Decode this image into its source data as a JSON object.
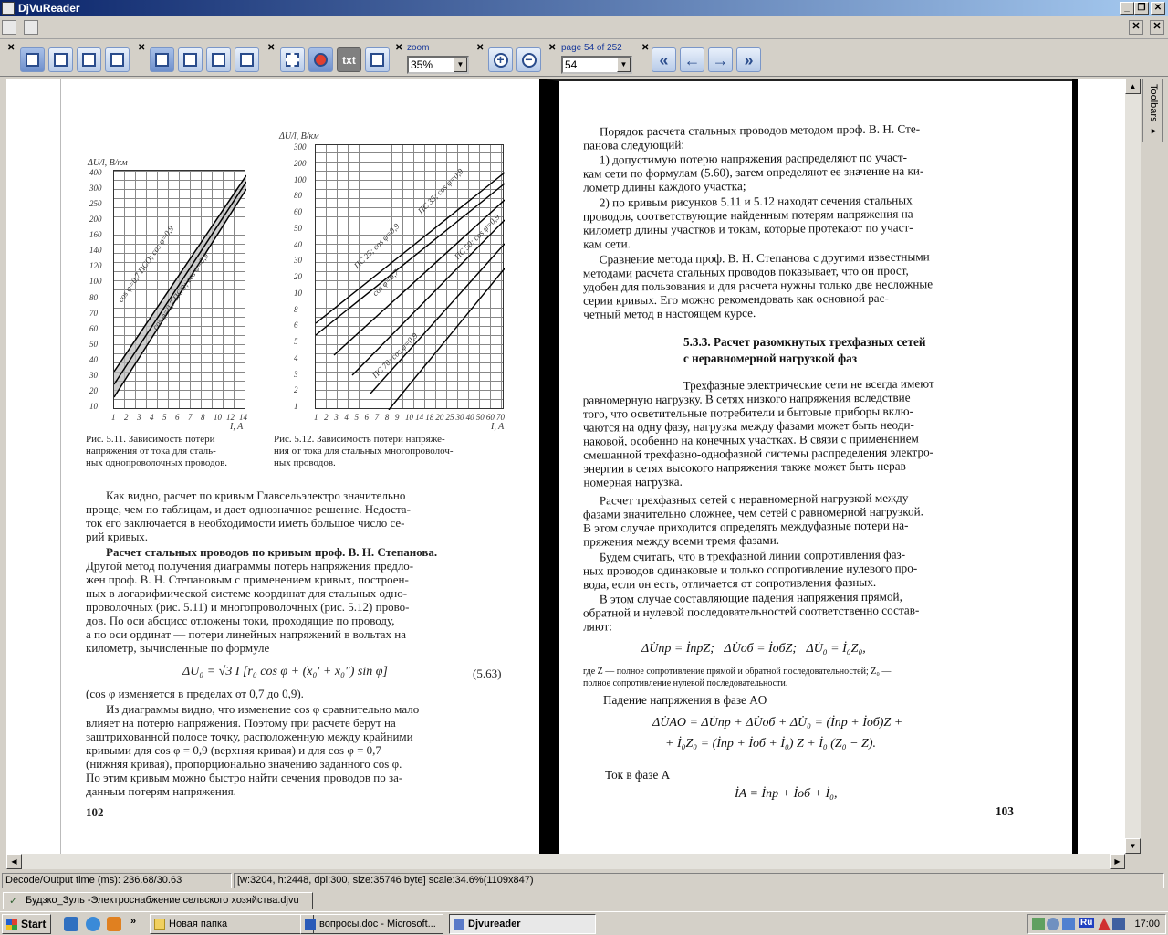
{
  "app": {
    "title": "DjVuReader"
  },
  "toolbar": {
    "zoom_label": "zoom",
    "zoom_value": "35%",
    "page_label": "page 54 of 252",
    "page_value": "54",
    "txt_button": "txt"
  },
  "side": {
    "toolbars_label": "Toolbars ▸"
  },
  "status": {
    "decode": "Decode/Output time (ms): 236.68/30.63",
    "info": "[w:3204, h:2448, dpi:300, size:35746 byte] scale:34.6%(1109x847)"
  },
  "file_tab": {
    "label": "Будзко_Зуль -Электроснабжение сельского хозяйства.djvu"
  },
  "taskbar": {
    "start": "Start",
    "tasks": [
      "Новая папка",
      "вопросы.doc - Microsoft...",
      "Djvureader"
    ],
    "lang": "Ru",
    "clock": "17:00"
  },
  "left_page": {
    "fig1_ylabel": "ΔU/l, В/км",
    "fig1_yticks": [
      "400",
      "300",
      "250",
      "200",
      "160",
      "140",
      "120",
      "100",
      "80",
      "70",
      "60",
      "50",
      "40",
      "30",
      "20",
      "10"
    ],
    "fig1_xticks": [
      "1",
      "2",
      "3",
      "4",
      "5",
      "6",
      "7",
      "8",
      "10",
      "12",
      "14"
    ],
    "fig1_curves": [
      "cos φ=0,7 ПСО; cos φ=0,9",
      "cos φ=0,7 ПСО; cos φ=0,9"
    ],
    "fig2_ylabel": "ΔU/l, В/км",
    "fig2_yticks": [
      "300",
      "200",
      "100",
      "80",
      "60",
      "50",
      "40",
      "30",
      "20",
      "10",
      "8",
      "6",
      "5",
      "4",
      "3",
      "2",
      "1"
    ],
    "fig2_xticks": [
      "1",
      "2",
      "3",
      "4",
      "5",
      "6",
      "7",
      "8",
      "9",
      "10",
      "14",
      "18",
      "20",
      "25",
      "30",
      "40",
      "50",
      "60",
      "70"
    ],
    "fig2_curves": [
      "ПС 25; cos φ=0,9",
      "cos φ=0,7",
      "ПС 35; cos φ=0,9",
      "ПС 50; cos φ=0,9",
      "ПС 70; cos φ=0,9"
    ],
    "axis_i": "I, A",
    "cap1": "Рис. 5.11. Зависимость потери\nнапряжения от тока для сталь-\nных однопроволочных проводов.",
    "cap2": "Рис. 5.12. Зависимость потери напряже-\nния от тока для стальных многопроволоч-\nных проводов.",
    "body1": "Как видно, расчет по кривым Главсельэлектро значительно\nпроще, чем по таблицам, и дает однозначное решение. Недоста-\nток его заключается в необходимости иметь большое число се-\nрий кривых.",
    "heading": "Расчет стальных проводов по кривым проф. В. Н. Степанова.",
    "body2": "Другой метод получения диаграммы потерь напряжения предло-\nжен проф. В. Н. Степановым с применением кривых, построен-\nных в логарифмической системе координат для стальных одно-\nпроволочных (рис. 5.11) и многопроволочных (рис. 5.12) прово-\nдов. По оси абсцисс отложены токи, проходящие по проводу,\nа по оси ординат — потери линейных напряжений в вольтах на\nкилометр, вычисленные по формуле",
    "formula": "ΔU₀ = √3 I [r₀ cos φ + (x₀′ + x₀″) sin φ]",
    "formula_no": "(5.63)",
    "body3": "(cos φ изменяется в пределах от 0,7 до 0,9).",
    "body4": "Из диаграммы видно, что изменение cos φ сравнительно мало\nвлияет на потерю напряжения. Поэтому при расчете берут на\nзаштрихованной полосе точку, расположенную между крайними\nкривыми для cos φ = 0,9 (верхняя кривая) и для cos φ = 0,7\n(нижняя кривая), пропорционально значению заданного cos φ.\nПо этим кривым можно быстро найти сечения проводов по за-\nданным потерям напряжения.",
    "page_no": "102"
  },
  "right_page": {
    "p1": "Порядок расчета стальных проводов методом проф. В. Н. Сте-\nпанова следующий:",
    "p2": "1) допустимую потерю напряжения распределяют по участ-\nкам сети по формулам (5.60), затем определяют ее значение на ки-\nлометр длины каждого участка;",
    "p3": "2) по кривым рисунков 5.11 и 5.12 находят сечения стальных\nпроводов, соответствующие найденным потерям напряжения на\nкилометр длины участков и токам, которые протекают по участ-\nкам сети.",
    "p4": "Сравнение метода проф. В. Н. Степанова с другими известными\nметодами расчета стальных проводов показывает, что он прост,\nудобен для пользования и для расчета нужны только две несложные\nсерии кривых. Его можно рекомендовать как основной рас-\nчетный метод в настоящем курсе.",
    "h1": "5.3.3. Расчет разомкнутых трехфазных сетей",
    "h2": "с неравномерной нагрузкой фаз",
    "p5": "Трехфазные электрические сети не всегда имеют\nравномерную нагрузку. В сетях низкого напряжения вследствие\nтого, что осветительные потребители и бытовые приборы вклю-\nчаются на одну фазу, нагрузка между фазами может быть неоди-\nнаковой, особенно на конечных участках. В связи с применением\nсмешанной трехфазно-однофазной системы распределения электро-\nэнергии в сетях высокого напряжения также может быть нерав-\nномерная нагрузка.",
    "p6": "Расчет трехфазных сетей с неравномерной нагрузкой между\nфазами значительно сложнее, чем сетей с равномерной нагрузкой.\nВ этом случае приходится определять междуфазные потери на-\nпряжения между всеми тремя фазами.",
    "p7": "Будем считать, что в трехфазной линии сопротивления фаз-\nных проводов одинаковые и только сопротивление нулевого про-\nвода, если он есть, отличается от сопротивления фазных.",
    "p8": "В этом случае составляющие падения напряжения прямой,\nобратной и нулевой последовательностей соответственно состав-\nляют:",
    "eq1": "ΔU̇пр = İпрZ;   ΔU̇об = İобZ;   ΔU̇₀ = İ₀Z₀,",
    "note": "где Z — полное сопротивление прямой и обратной последовательностей; Z₀ —\nполное сопротивление нулевой последовательности.",
    "p9": "Падение напряжения в фазе AO",
    "eq2": "ΔU̇AO = ΔU̇пр + ΔU̇об + ΔU̇₀ = (İпр + İоб)Z +",
    "eq3": "+ İ₀Z₀ = (İпр + İоб + İ₀) Z + İ₀ (Z₀ − Z).",
    "p10": "Ток в фазе A",
    "eq4": "İA = İпр + İоб + İ₀,",
    "page_no": "103"
  }
}
